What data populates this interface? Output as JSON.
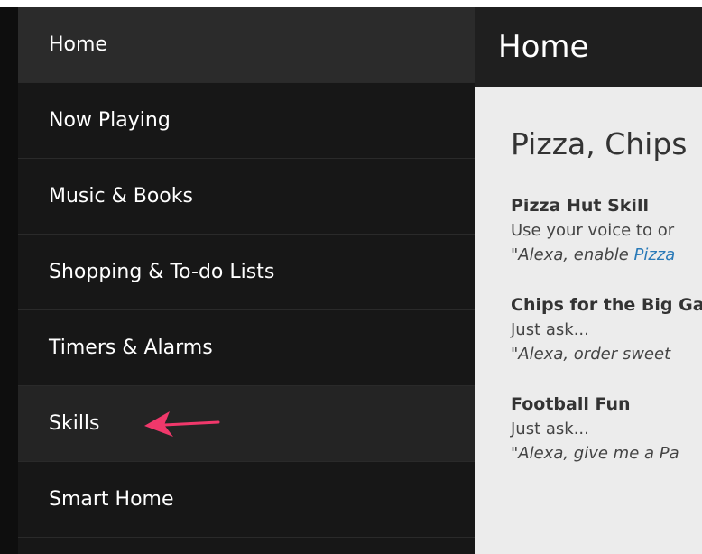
{
  "sidebar": {
    "items": [
      {
        "label": "Home"
      },
      {
        "label": "Now Playing"
      },
      {
        "label": "Music & Books"
      },
      {
        "label": "Shopping & To-do Lists"
      },
      {
        "label": "Timers & Alarms"
      },
      {
        "label": "Skills"
      },
      {
        "label": "Smart Home"
      }
    ]
  },
  "main": {
    "header": "Home",
    "section_title": "Pizza, Chips",
    "cards": [
      {
        "title": "Pizza Hut Skill",
        "desc": "Use your voice to or",
        "example_prefix": "\"Alexa, enable ",
        "example_link": "Pizza"
      },
      {
        "title": "Chips for the Big Ga",
        "desc": "Just ask...",
        "example_prefix": "\"Alexa, order sweet ",
        "example_link": ""
      },
      {
        "title": "Football Fun",
        "desc": "Just ask...",
        "example_prefix": "\"Alexa, give me a Pa",
        "example_link": ""
      }
    ]
  },
  "annotation": {
    "color": "#f0386b",
    "icon": "arrow-left-icon"
  }
}
